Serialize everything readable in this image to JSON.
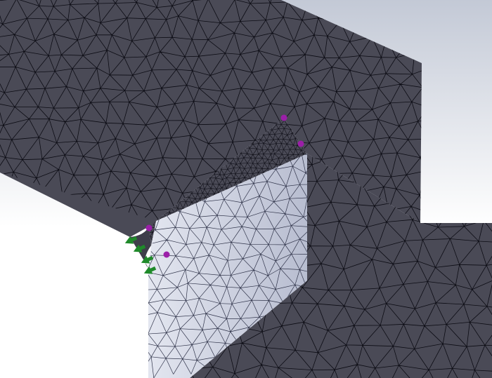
{
  "viewport": {
    "background_top": "#c3c9d6",
    "background_bottom": "#ffffff",
    "render_mode": "shaded-with-mesh-edges"
  },
  "model": {
    "dark_face_color": "#4a4a56",
    "light_face_color": "#c9cddd",
    "mesh_edge_color": "#0c0c14",
    "mesh_refined_near_corner": true
  },
  "markers": {
    "fixture_color": "#9b1fa8",
    "fixture_count": 4,
    "load_color": "#1f8a2a",
    "load_arrow_count": 4,
    "load_arrow_icon": "arrow-icon"
  }
}
